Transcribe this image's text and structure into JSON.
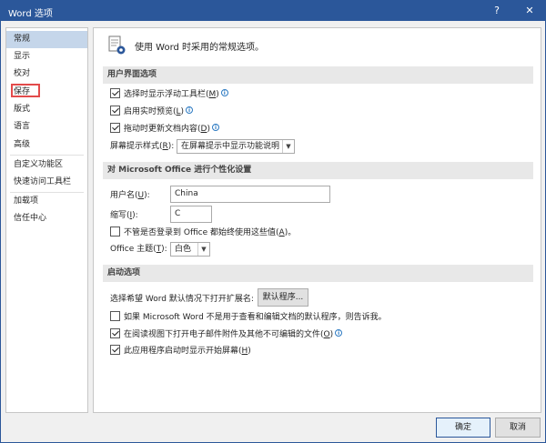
{
  "window": {
    "title": "Word 选项",
    "help_glyph": "?",
    "close_glyph": "✕"
  },
  "sidebar": {
    "items": [
      {
        "label": "常规",
        "selected": true
      },
      {
        "label": "显示"
      },
      {
        "label": "校对"
      },
      {
        "label": "保存"
      },
      {
        "label": "版式"
      },
      {
        "label": "语言"
      },
      {
        "label": "高级"
      },
      {
        "label": "自定义功能区"
      },
      {
        "label": "快速访问工具栏"
      },
      {
        "label": "加载项"
      },
      {
        "label": "信任中心"
      }
    ]
  },
  "content": {
    "intro": "使用 Word 时采用的常规选项。",
    "ui_section": {
      "header": "用户界面选项",
      "mini_toolbar": {
        "label": "选择时显示浮动工具栏(",
        "key": "M",
        "suffix": ")",
        "checked": true
      },
      "live_preview": {
        "label": "启用实时预览(",
        "key": "L",
        "suffix": ")",
        "checked": true
      },
      "update_content": {
        "label": "拖动时更新文档内容(",
        "key": "D",
        "suffix": ")",
        "checked": true
      },
      "screentip": {
        "label": "屏幕提示样式(",
        "key": "R",
        "suffix": "):",
        "value": "在屏幕提示中显示功能说明"
      }
    },
    "personalize_section": {
      "header": "对 Microsoft Office 进行个性化设置",
      "username_label": "用户名(",
      "username_key": "U",
      "username_suffix": "):",
      "username_value": "China",
      "initials_label": "缩写(",
      "initials_key": "I",
      "initials_suffix": "):",
      "initials_value": "C",
      "always_use": {
        "label": "不管是否登录到 Office 都始终使用这些值(",
        "key": "A",
        "suffix": ")。",
        "checked": false
      },
      "theme_label": "Office 主题(",
      "theme_key": "T",
      "theme_suffix": "):",
      "theme_value": "白色"
    },
    "startup_section": {
      "header": "启动选项",
      "default_ext_label": "选择希望 Word 默认情况下打开扩展名:",
      "default_programs_button": "默认程序...",
      "tell_me": {
        "label": "如果 Microsoft Word 不是用于查看和编辑文档的默认程序，则告诉我。",
        "checked": false
      },
      "reading_view": {
        "label": "在阅读视图下打开电子邮件附件及其他不可编辑的文件(",
        "key": "O",
        "suffix": ")",
        "checked": true
      },
      "start_screen": {
        "label": "此应用程序启动时显示开始屏幕(",
        "key": "H",
        "suffix": ")",
        "checked": true
      }
    }
  },
  "footer": {
    "ok_label": "确定",
    "cancel_label": "取消"
  },
  "icons": {
    "info": "i",
    "dropdown": "▼"
  },
  "colors": {
    "titlebar": "#2b579a",
    "selected_nav": "#c5d6ea",
    "highlight": "#e34b4b"
  }
}
